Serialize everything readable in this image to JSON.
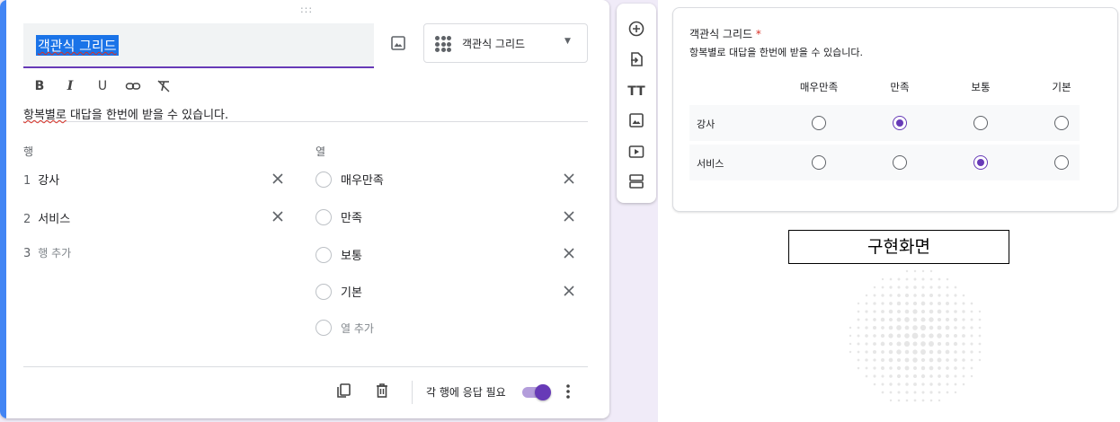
{
  "editor": {
    "drag_handle": ":::",
    "question_title": "객관식 그리드",
    "question_type": "객관식 그리드",
    "type_icon": "grid-icon",
    "format_tools": [
      {
        "label": "B",
        "name": "bold"
      },
      {
        "label": "I",
        "name": "italic"
      },
      {
        "label": "U",
        "name": "underline"
      },
      {
        "label": "link-icon",
        "name": "link"
      },
      {
        "label": "clear-format-icon",
        "name": "clear-format"
      }
    ],
    "description_underlined": "항복별로",
    "description_rest": " 대답을 한번에 받을 수 있습니다.",
    "rows_header": "행",
    "columns_header": "열",
    "rows": [
      {
        "num": "1",
        "label": "강사"
      },
      {
        "num": "2",
        "label": "서비스"
      }
    ],
    "add_row": {
      "num": "3",
      "label": "행 추가"
    },
    "columns": [
      "매우만족",
      "만족",
      "보통",
      "기본"
    ],
    "add_column": "열 추가",
    "require_label": "각 행에 응답 필요",
    "require_on": true
  },
  "toolbar": {
    "icons": [
      "add-question-icon",
      "import-questions-icon",
      "add-title-icon",
      "add-image-icon",
      "add-video-icon",
      "add-section-icon"
    ],
    "title_icon_label": "TT"
  },
  "preview": {
    "title": "객관식 그리드",
    "required_marker": "*",
    "description": "항복별로 대답을 한번에 받을 수 있습니다.",
    "columns": [
      "매우만족",
      "만족",
      "보통",
      "기본"
    ],
    "rows": [
      {
        "label": "강사",
        "selected": 1
      },
      {
        "label": "서비스",
        "selected": 2
      }
    ]
  },
  "caption": "구현화면",
  "colors": {
    "accent_blue": "#4285f4",
    "accent_purple": "#673ab7",
    "required_red": "#d93025"
  }
}
